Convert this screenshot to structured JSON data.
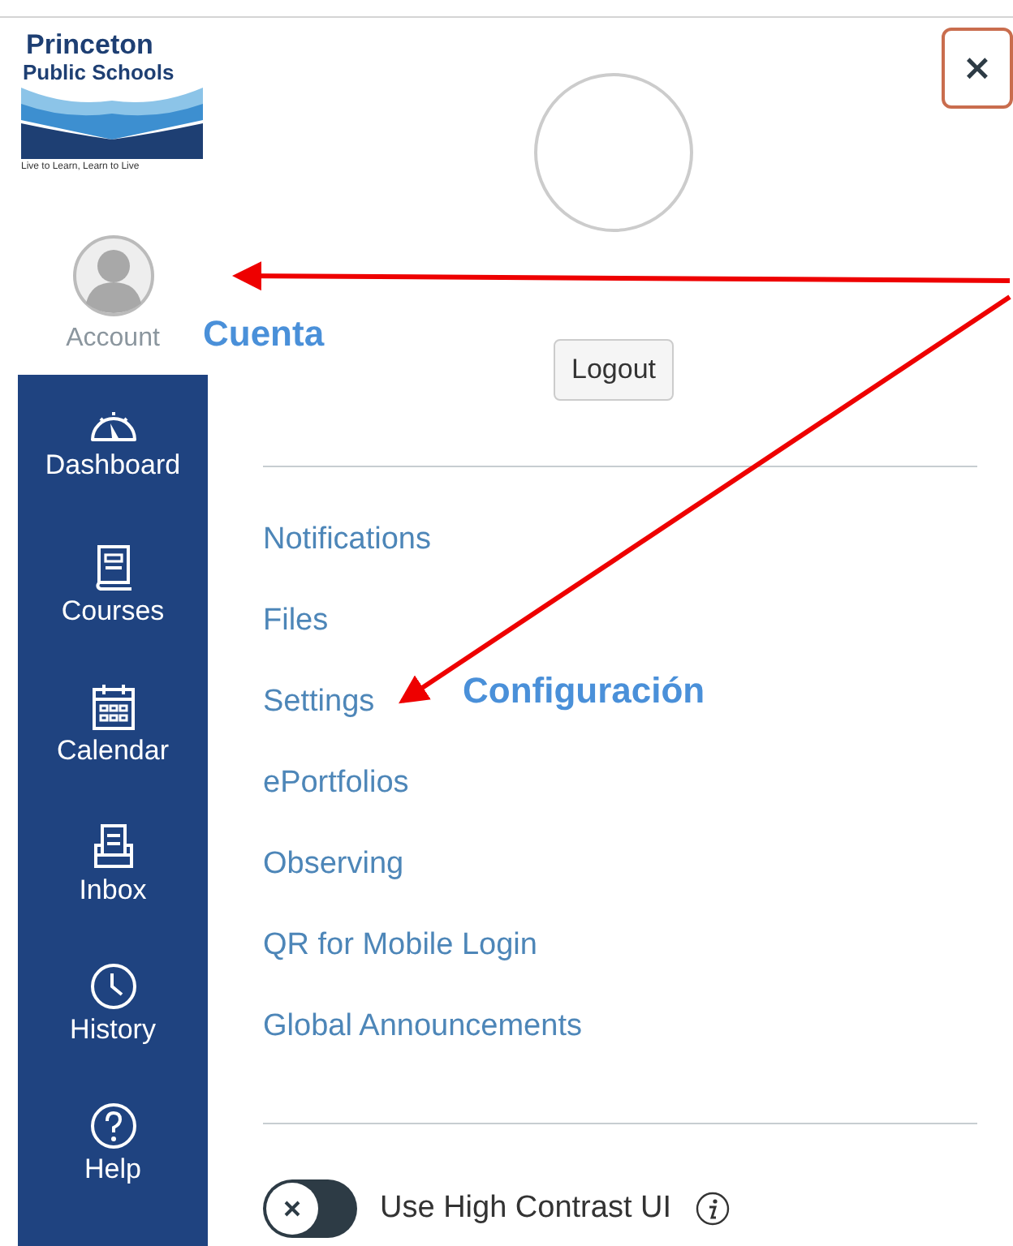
{
  "logo": {
    "name_line_1": "Princeton",
    "name_line_2": "Public Schools",
    "tagline": "Live to Learn, Learn to Live"
  },
  "global_nav": [
    {
      "label": "Account",
      "selected": true
    },
    {
      "label": "Dashboard",
      "selected": false
    },
    {
      "label": "Courses",
      "selected": false
    },
    {
      "label": "Calendar",
      "selected": false
    },
    {
      "label": "Inbox",
      "selected": false
    },
    {
      "label": "History",
      "selected": false
    },
    {
      "label": "Help",
      "selected": false
    }
  ],
  "account_tray": {
    "close_button": "×",
    "logout_button": "Logout",
    "links": [
      "Notifications",
      "Files",
      "Settings",
      "ePortfolios",
      "Observing",
      "QR for Mobile Login",
      "Global Announcements"
    ],
    "high_contrast": {
      "label": "Use High Contrast UI",
      "on": false
    }
  },
  "annotations": [
    {
      "text": "Cuenta"
    },
    {
      "text": "Configuración"
    }
  ]
}
